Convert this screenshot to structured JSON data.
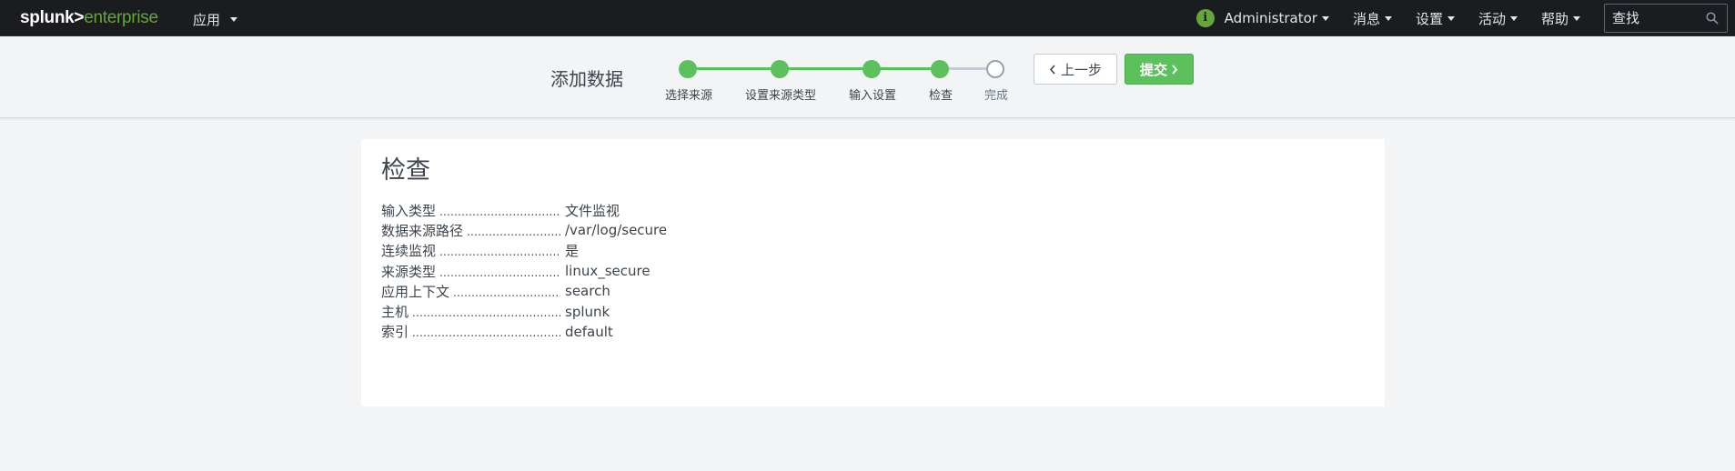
{
  "nav": {
    "logo_left": "splunk>",
    "logo_right": "enterprise",
    "app_menu": "应用",
    "info_icon": "i",
    "user_menu": "Administrator",
    "messages_menu": "消息",
    "settings_menu": "设置",
    "activity_menu": "活动",
    "help_menu": "帮助",
    "search_placeholder": "查找"
  },
  "wizard": {
    "title": "添加数据",
    "steps": [
      {
        "label": "选择来源",
        "done": true
      },
      {
        "label": "设置来源类型",
        "done": true
      },
      {
        "label": "输入设置",
        "done": true
      },
      {
        "label": "检查",
        "done": true
      },
      {
        "label": "完成",
        "done": false
      }
    ],
    "back_label": "上一步",
    "submit_label": "提交"
  },
  "review": {
    "title": "检查",
    "rows": [
      {
        "key": "输入类型",
        "value": "文件监视"
      },
      {
        "key": "数据来源路径",
        "value": "/var/log/secure"
      },
      {
        "key": "连续监视",
        "value": "是"
      },
      {
        "key": "来源类型",
        "value": "linux_secure"
      },
      {
        "key": "应用上下文",
        "value": "search"
      },
      {
        "key": "主机",
        "value": "splunk"
      },
      {
        "key": "索引",
        "value": "default"
      }
    ]
  },
  "colors": {
    "accent_green": "#5cc05c",
    "nav_bg": "#1a1c20",
    "logo_green": "#65a637"
  }
}
